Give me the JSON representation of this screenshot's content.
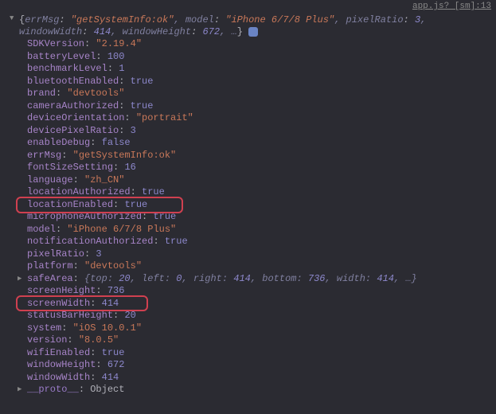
{
  "header": "app.js? [sm]:13",
  "summary": {
    "errMsg_key": "errMsg",
    "errMsg_val": "\"getSystemInfo:ok\"",
    "model_key": "model",
    "model_val": "\"iPhone 6/7/8 Plus\"",
    "pixelRatio_key": "pixelRatio",
    "pixelRatio_val": "3",
    "windowWidth_key": "windowWidth",
    "windowWidth_val": "414",
    "windowHeight_key": "windowHeight",
    "windowHeight_val": "672",
    "ellipsis": ", …"
  },
  "props": [
    {
      "k": "SDKVersion",
      "v": "\"2.19.4\"",
      "t": "str"
    },
    {
      "k": "batteryLevel",
      "v": "100",
      "t": "num"
    },
    {
      "k": "benchmarkLevel",
      "v": "1",
      "t": "num"
    },
    {
      "k": "bluetoothEnabled",
      "v": "true",
      "t": "bool"
    },
    {
      "k": "brand",
      "v": "\"devtools\"",
      "t": "str"
    },
    {
      "k": "cameraAuthorized",
      "v": "true",
      "t": "bool"
    },
    {
      "k": "deviceOrientation",
      "v": "\"portrait\"",
      "t": "str"
    },
    {
      "k": "devicePixelRatio",
      "v": "3",
      "t": "num"
    },
    {
      "k": "enableDebug",
      "v": "false",
      "t": "bool"
    },
    {
      "k": "errMsg",
      "v": "\"getSystemInfo:ok\"",
      "t": "str"
    },
    {
      "k": "fontSizeSetting",
      "v": "16",
      "t": "num"
    },
    {
      "k": "language",
      "v": "\"zh_CN\"",
      "t": "str"
    },
    {
      "k": "locationAuthorized",
      "v": "true",
      "t": "bool"
    },
    {
      "k": "locationEnabled",
      "v": "true",
      "t": "bool"
    },
    {
      "k": "microphoneAuthorized",
      "v": "true",
      "t": "bool"
    },
    {
      "k": "model",
      "v": "\"iPhone 6/7/8 Plus\"",
      "t": "str"
    },
    {
      "k": "notificationAuthorized",
      "v": "true",
      "t": "bool"
    },
    {
      "k": "pixelRatio",
      "v": "3",
      "t": "num"
    },
    {
      "k": "platform",
      "v": "\"devtools\"",
      "t": "str"
    },
    {
      "k": "safeArea",
      "v": "{top: 20, left: 0, right: 414, bottom: 736, width: 414, …}",
      "t": "obj",
      "expandable": true
    },
    {
      "k": "screenHeight",
      "v": "736",
      "t": "num"
    },
    {
      "k": "screenWidth",
      "v": "414",
      "t": "num"
    },
    {
      "k": "statusBarHeight",
      "v": "20",
      "t": "num"
    },
    {
      "k": "system",
      "v": "\"iOS 10.0.1\"",
      "t": "str"
    },
    {
      "k": "version",
      "v": "\"8.0.5\"",
      "t": "str"
    },
    {
      "k": "wifiEnabled",
      "v": "true",
      "t": "bool"
    },
    {
      "k": "windowHeight",
      "v": "672",
      "t": "num"
    },
    {
      "k": "windowWidth",
      "v": "414",
      "t": "num"
    }
  ],
  "proto": {
    "k": "__proto__",
    "v": "Object"
  },
  "safeAreaPreview": {
    "top": "20",
    "left": "0",
    "right": "414",
    "bottom": "736",
    "width": "414"
  }
}
